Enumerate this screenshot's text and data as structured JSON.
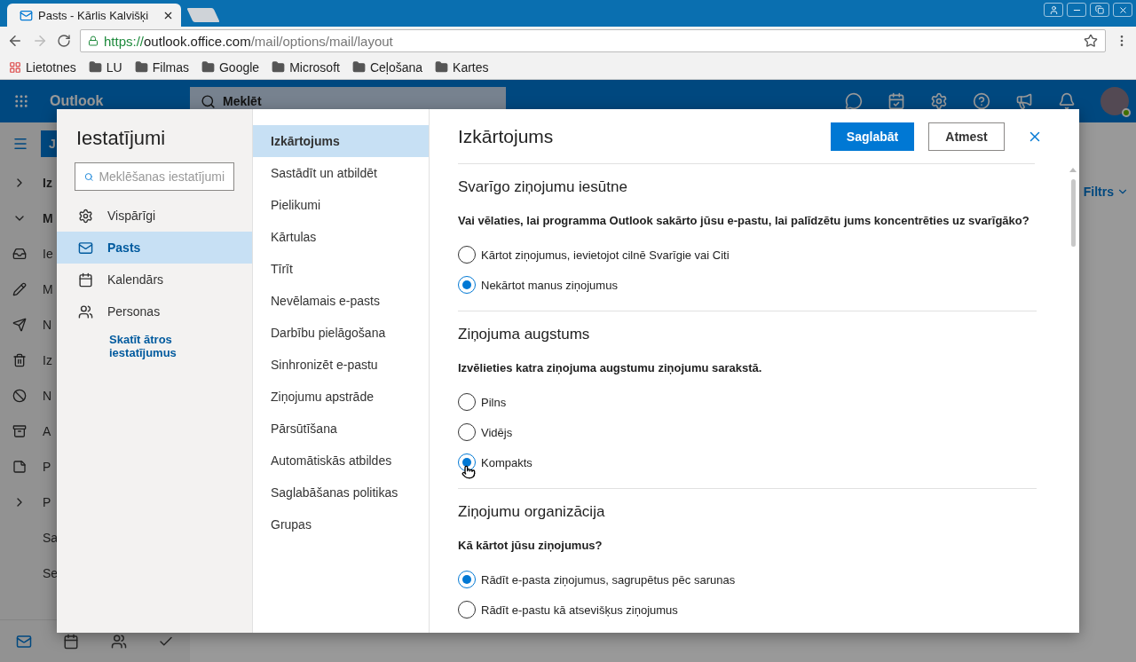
{
  "browser": {
    "tab_title": "Pasts - Kārlis Kalvišķi",
    "url_scheme": "https://",
    "url_host": "outlook.office.com",
    "url_path": "/mail/options/mail/layout",
    "bookmarks": [
      {
        "label": "Lietotnes",
        "kind": "apps"
      },
      {
        "label": "LU",
        "kind": "folder"
      },
      {
        "label": "Filmas",
        "kind": "folder"
      },
      {
        "label": "Google",
        "kind": "folder"
      },
      {
        "label": "Microsoft",
        "kind": "folder"
      },
      {
        "label": "Ceļošana",
        "kind": "folder"
      },
      {
        "label": "Kartes",
        "kind": "folder"
      }
    ]
  },
  "outlook": {
    "app_name": "Outlook",
    "search_placeholder": "Meklēt",
    "new_button": "J",
    "filter_label": "Filtrs",
    "rail": [
      {
        "label": "Iz",
        "kind": "group-collapsed"
      },
      {
        "label": "M",
        "kind": "group-expanded"
      },
      {
        "label": "Ie",
        "kind": "inbox"
      },
      {
        "label": "M",
        "kind": "drafts"
      },
      {
        "label": "N",
        "kind": "sent"
      },
      {
        "label": "Iz",
        "kind": "deleted"
      },
      {
        "label": "N",
        "kind": "junk"
      },
      {
        "label": "A",
        "kind": "archive"
      },
      {
        "label": "P",
        "kind": "notes"
      },
      {
        "label": "P",
        "kind": "folder"
      },
      {
        "label": "Sa",
        "kind": "plain"
      },
      {
        "label": "Se",
        "kind": "plain"
      }
    ],
    "bottom_nav": [
      {
        "kind": "mail",
        "selected": true
      },
      {
        "kind": "calendar",
        "selected": false
      },
      {
        "kind": "people",
        "selected": false
      },
      {
        "kind": "tasks",
        "selected": false
      }
    ]
  },
  "settings": {
    "title": "Iestatījumi",
    "search_placeholder": "Meklēšanas iestatījumi",
    "categories": [
      {
        "label": "Vispārīgi",
        "kind": "general",
        "selected": false
      },
      {
        "label": "Pasts",
        "kind": "mail",
        "selected": true
      },
      {
        "label": "Kalendārs",
        "kind": "calendar",
        "selected": false
      },
      {
        "label": "Personas",
        "kind": "people",
        "selected": false
      }
    ],
    "quick_link": "Skatīt ātros iestatījumus",
    "subcategories": [
      {
        "label": "Izkārtojums",
        "selected": true
      },
      {
        "label": "Sastādīt un atbildēt",
        "selected": false
      },
      {
        "label": "Pielikumi",
        "selected": false
      },
      {
        "label": "Kārtulas",
        "selected": false
      },
      {
        "label": "Tīrīt",
        "selected": false
      },
      {
        "label": "Nevēlamais e-pasts",
        "selected": false
      },
      {
        "label": "Darbību pielāgošana",
        "selected": false
      },
      {
        "label": "Sinhronizēt e-pastu",
        "selected": false
      },
      {
        "label": "Ziņojumu apstrāde",
        "selected": false
      },
      {
        "label": "Pārsūtīšana",
        "selected": false
      },
      {
        "label": "Automātiskās atbildes",
        "selected": false
      },
      {
        "label": "Saglabāšanas politikas",
        "selected": false
      },
      {
        "label": "Grupas",
        "selected": false
      }
    ],
    "page_title": "Izkārtojums",
    "save_button": "Saglabāt",
    "discard_button": "Atmest",
    "sections": [
      {
        "title": "Svarīgo ziņojumu iesūtne",
        "question": "Vai vēlaties, lai programma Outlook sakārto jūsu e-pastu, lai palīdzētu jums koncentrēties uz svarīgāko?",
        "options": [
          {
            "label": "Kārtot ziņojumus, ievietojot cilnē Svarīgie vai Citi",
            "selected": false
          },
          {
            "label": "Nekārtot manus ziņojumus",
            "selected": true
          }
        ]
      },
      {
        "title": "Ziņojuma augstums",
        "question": "Izvēlieties katra ziņojuma augstumu ziņojumu sarakstā.",
        "options": [
          {
            "label": "Pilns",
            "selected": false
          },
          {
            "label": "Vidējs",
            "selected": false
          },
          {
            "label": "Kompakts",
            "selected": true,
            "pointer": true
          }
        ]
      },
      {
        "title": "Ziņojumu organizācija",
        "question": "Kā kārtot jūsu ziņojumus?",
        "options": [
          {
            "label": "Rādīt e-pasta ziņojumus, sagrupētus pēc sarunas",
            "selected": true
          },
          {
            "label": "Rādīt e-pastu kā atsevišķus ziņojumus",
            "selected": false
          }
        ]
      }
    ]
  }
}
